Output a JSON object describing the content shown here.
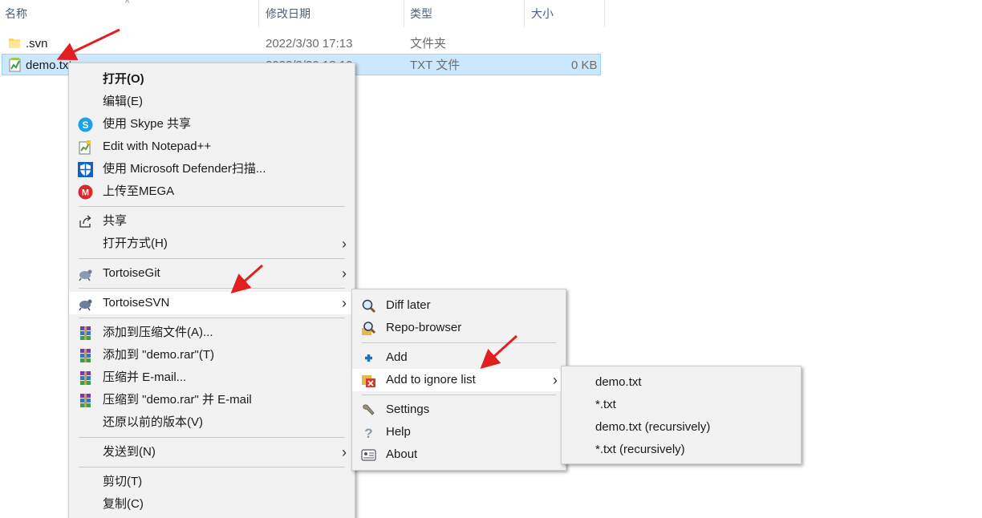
{
  "columns": [
    "名称",
    "修改日期",
    "类型",
    "大小"
  ],
  "files": [
    {
      "name": ".svn",
      "date": "2022/3/30 17:13",
      "type": "文件夹",
      "size": "",
      "icon": "folder-icon"
    },
    {
      "name": "demo.txt",
      "date": "2022/3/30 18:10",
      "type": "TXT 文件",
      "size": "0 KB",
      "icon": "text-file-icon"
    }
  ],
  "context_menu": {
    "items": [
      {
        "label": "打开(O)",
        "icon": ""
      },
      {
        "label": "编辑(E)",
        "icon": ""
      },
      {
        "label": "使用 Skype 共享",
        "icon": "skype-icon"
      },
      {
        "label": "Edit with Notepad++",
        "icon": "notepad-plus-plus-icon"
      },
      {
        "label": "使用 Microsoft Defender扫描...",
        "icon": "defender-shield-icon"
      },
      {
        "label": "上传至MEGA",
        "icon": "mega-icon"
      },
      {
        "label": "共享",
        "icon": "share-icon"
      },
      {
        "label": "打开方式(H)",
        "icon": ""
      },
      {
        "label": "TortoiseGit",
        "icon": "tortoisegit-icon"
      },
      {
        "label": "TortoiseSVN",
        "icon": "tortoisesvn-icon"
      },
      {
        "label": "添加到压缩文件(A)...",
        "icon": "winrar-icon"
      },
      {
        "label": "添加到 \"demo.rar\"(T)",
        "icon": "winrar-icon"
      },
      {
        "label": "压缩并 E-mail...",
        "icon": "winrar-icon"
      },
      {
        "label": "压缩到 \"demo.rar\" 并 E-mail",
        "icon": "winrar-icon"
      },
      {
        "label": "还原以前的版本(V)",
        "icon": ""
      },
      {
        "label": "发送到(N)",
        "icon": ""
      },
      {
        "label": "剪切(T)",
        "icon": ""
      },
      {
        "label": "复制(C)",
        "icon": ""
      }
    ]
  },
  "svn_menu": {
    "items": [
      {
        "label": "Diff later",
        "icon": "diff-magnifier-icon"
      },
      {
        "label": "Repo-browser",
        "icon": "repo-browser-icon"
      },
      {
        "label": "Add",
        "icon": "add-plus-icon"
      },
      {
        "label": "Add to ignore list",
        "icon": "ignore-list-icon"
      },
      {
        "label": "Settings",
        "icon": "settings-wrench-icon"
      },
      {
        "label": "Help",
        "icon": "help-icon"
      },
      {
        "label": "About",
        "icon": "about-icon"
      }
    ]
  },
  "ignore_menu": {
    "items": [
      "demo.txt",
      "*.txt",
      "demo.txt (recursively)",
      "*.txt (recursively)"
    ]
  },
  "colors": {
    "selection_bg": "#cce8ff",
    "selection_border": "#99d1ff",
    "menu_bg": "#f2f2f2",
    "annotation_arrow": "#e02020"
  }
}
